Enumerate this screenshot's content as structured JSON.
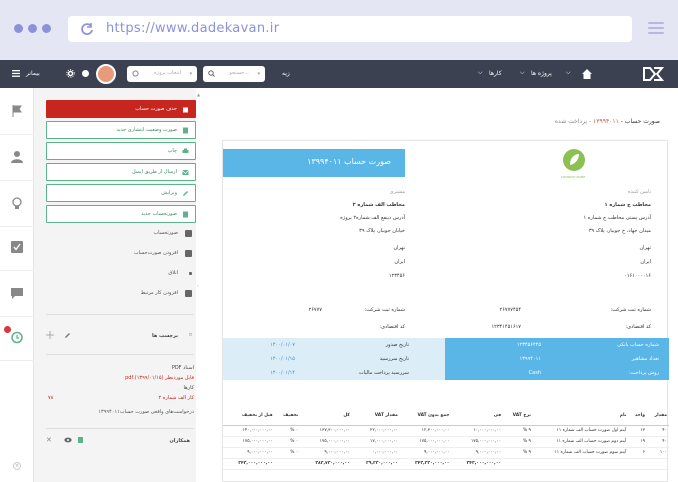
{
  "browser": {
    "url": "https://www.dadekavan.ir"
  },
  "topbar": {
    "brand_icon": "dk-logo-icon",
    "home_icon": "home-icon",
    "projects_label": "پروژه ها",
    "tasks_label": "کارها",
    "all_label": "زیه",
    "search_placeholder": "جستجو...",
    "project_select_placeholder": "انتخاب پروژه",
    "user_name": "بیمانر"
  },
  "sidebar": {
    "delete_label": "حذف صورت حساب",
    "buttons": [
      {
        "label": "صورت وضعیت انتشاری جدید",
        "icon": "doc-icon"
      },
      {
        "label": "چاپ",
        "icon": "print-icon"
      },
      {
        "label": "ارسال از طریق ایمیل",
        "icon": "mail-icon"
      },
      {
        "label": "ویرایش",
        "icon": "pencil-icon"
      },
      {
        "label": "صورتحساب جدید",
        "icon": "file-icon"
      }
    ],
    "plain_items": [
      "صورتحساب",
      "افزودن صورت‌حساب",
      "اتلاق",
      "افزودن کار مرتبط"
    ],
    "labels_title": "برچسب ها",
    "labels_value": "",
    "pdf_title": "اسناد PDF",
    "pdf_file": "فایل موردنظر (۱۳۹۹/۰۱/۱۵).pdf",
    "tasks_title": "کارها",
    "task_item": "کار الف شماره ۲",
    "task_percent": "۷۸",
    "requests_title": "درخواست‌های واقعی صورت حساب‌۱۳۹۹۴۰۱۱",
    "collaborators_title": "همکاران"
  },
  "document": {
    "header_title": "صورت حساب - ",
    "header_number": "۱۳۹۹۴۰۱۱",
    "header_status": " - پرداخت شده",
    "invoice_title": "صورت حساب ۱۳۹۹۴۰۱۱",
    "logo_text": "COMPANY NAME",
    "seller_label": "تامین کننده",
    "seller_name": "مخاطب ج شماره ۱",
    "seller_lines": [
      "آدرس پستی مخاطب ج شماره ۱",
      "میدان جهاد، خ جوببار، پلاک ۳۹",
      "تهران",
      "ایران",
      "۰۱۶۱۰۰۰۰۱۶"
    ],
    "buyer_label": "مشتری",
    "buyer_name": "مخاطب الف شماره ۲",
    "buyer_lines": [
      "آدرس ذینفع الف شماره۲ پروژه",
      "خیابان جوببار، پلاک ۳۹",
      "تهران",
      "ایران",
      "۱۲۳۴۵۶"
    ],
    "seller_reg_label": "شماره ثبت شرکت:",
    "seller_reg_value": "۲۶۷۷۷۴۵۴",
    "seller_eco_label": "کد اقتصادی:",
    "seller_eco_value": "۱۲۳۴۱۴۵۱۶۱۷",
    "buyer_reg_label": "شماره ثبت شرکت:",
    "buyer_reg_value": "۲۶۷۷۷",
    "buyer_eco_label": "کد اقتصادی:",
    "buyer_eco_value": "",
    "bank_label": "شماره حساب بانکی",
    "bank_value": "۱۲۳۴۵۶۲۴۵",
    "quote_label": "تعداد مشاهیر",
    "quote_value": "۱۳۹۹۴۰۱۱",
    "pay_label": "روش پرداخت:",
    "pay_value": "Cash",
    "issue_label": "تاریخ صدور",
    "issue_value": "۱۴۰۰/۰۱/۰۷",
    "due_label": "تاریخ سررسید",
    "due_value": "۱۴۰۰/۰۱/۱۵",
    "tax_label": "سررسید پرداخت مالیات",
    "tax_value": "۱۴۰۰/۰۱/۱۴",
    "table": {
      "headers": [
        "مقدار",
        "واحد",
        "نام",
        "",
        "نرخ VAT",
        "فی",
        "جمع بدون VAT",
        "مقدار VAT",
        "کل",
        "تخفیف",
        "قبل از تخفیف"
      ],
      "rows": [
        [
          "۴۰",
          "۱۳",
          "آیتم اول صورت حساب الف شماره ۱۱",
          "",
          "۹ %",
          "۱۰,۰۰۰,۰۰۰,۰۰",
          "۱۲,۳۰۰,۰۰۰,۰۰",
          "۲۲,۰۰۰,۰۰۰,۰۰",
          "۱۳۷,۳۰۰,۰۰۰,۰۰",
          "۰ %",
          "۱۴۰,۰۰۰,۰۰۰,۰۰"
        ],
        [
          "۴۰",
          "۱۹",
          "آیتم دوم صورت حساب الف شماره ۱۱",
          "",
          "۹ %",
          "۱۷۵,۰۰۰,۰۰۰,۰۰",
          "۱۷۵,۰۰۰,۰۰۰,۰۰",
          "۱۷,۰۰۰,۰۰۰,۰۰",
          "۱۷۵,۰۰۰,۰۰۰,۰۰",
          "۰ %",
          "۱۷۵,۰۰۰,۰۰۰,۰۰"
        ],
        [
          "۱۰۰",
          "۶",
          "آیتم سوم صورت حساب الف شماره ۱۱",
          "",
          "۹ %",
          "۹,۰۰۰,۰۰۰,۰۰",
          "۹,۰۰۰,۰۰۰,۰۰",
          "۰,۰۰۰,۰۰۰,۰۰",
          "۹,۰۰۰,۰۰۰,۰۰",
          "۰ %",
          "۹,۰۰۰,۰۰۰,۰۰"
        ]
      ],
      "total": [
        "",
        "",
        "",
        "",
        "",
        "۳۴۳,۰۰۰,۰۰۰,۰۰",
        "۳۴۳,۲۳۰,۰۰۰,۰۰",
        "۳۹,۲۳۰,۰۰۰,۰۰",
        "۳۸۲,۷۳۰,۰۰۰,۰۰",
        "",
        "۳۴۳,۰۰۰,۰۰۰,۰۰"
      ]
    }
  },
  "colors": {
    "accent_blue": "#5bb6e8",
    "danger": "#c7261e",
    "green": "#5cb38a",
    "appbar": "#3b4150"
  }
}
